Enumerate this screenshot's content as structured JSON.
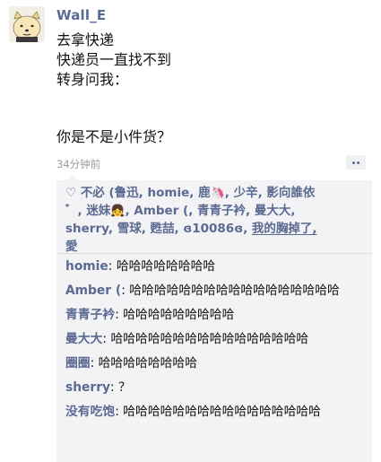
{
  "post": {
    "author": "Wall_E",
    "lines": [
      "去拿快递",
      "快递员一直找不到",
      "转身问我：",
      "你是不是小件货？"
    ],
    "time": "34分钟前"
  },
  "likes": {
    "line1": "不必 (鲁迅, homie, 鹿",
    "line1b": ", 少辛, 影向誰依",
    "line2a": "゛, 迷妹",
    "line2b": ", Amber (, 青青子衿, 曼大大,",
    "line3a": "sherry, 雪球, 甦喆, ɞ10086ɞ,",
    "line3b": "我的胸掉了,",
    "line4": "愛"
  },
  "comments": [
    {
      "name": "homie",
      "text": "哈哈哈哈哈哈哈哈"
    },
    {
      "name": "Amber (",
      "text": "哈哈哈哈哈哈哈哈哈哈哈哈哈哈哈哈哈"
    },
    {
      "name": "青青子衿",
      "text": "哈哈哈哈哈哈哈哈哈"
    },
    {
      "name": "曼大大",
      "text": "哈哈哈哈哈哈哈哈哈哈哈哈哈哈哈哈"
    },
    {
      "name": "圈圈",
      "text": "哈哈哈哈哈哈哈哈"
    },
    {
      "name": "sherry",
      "text": "？"
    },
    {
      "name": "没有吃饱",
      "text": "哈哈哈哈哈哈哈哈哈哈哈哈哈哈哈哈"
    }
  ],
  "icons": {
    "like": "heart-outline-icon",
    "unicorn": "unicorn-emoji-icon",
    "girl": "girl-emoji-icon",
    "more": "more-dots-icon",
    "avatar": "cartoon-dog-avatar"
  },
  "colors": {
    "name_link": "#5b6a92",
    "panel_bg": "#f3f3f5",
    "time": "#9b9b9b"
  }
}
